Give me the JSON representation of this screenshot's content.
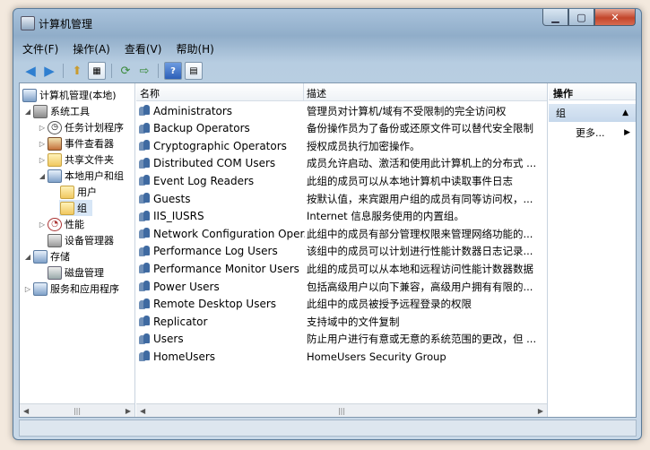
{
  "window": {
    "title": "计算机管理"
  },
  "menu": [
    "文件(F)",
    "操作(A)",
    "查看(V)",
    "帮助(H)"
  ],
  "toolbar": [
    "back-icon",
    "forward-icon",
    "up-icon",
    "show-tree-icon",
    "refresh-icon",
    "export-icon",
    "help-icon",
    "properties-icon"
  ],
  "tree": [
    {
      "label": "计算机管理(本地)",
      "icon": "computer-management-icon"
    },
    {
      "label": "系统工具",
      "icon": "tools-icon"
    },
    {
      "label": "任务计划程序",
      "icon": "clock-icon"
    },
    {
      "label": "事件查看器",
      "icon": "event-viewer-icon"
    },
    {
      "label": "共享文件夹",
      "icon": "shared-folder-icon"
    },
    {
      "label": "本地用户和组",
      "icon": "users-icon"
    },
    {
      "label": "用户",
      "icon": "folder-icon"
    },
    {
      "label": "组",
      "icon": "folder-icon"
    },
    {
      "label": "性能",
      "icon": "performance-icon"
    },
    {
      "label": "设备管理器",
      "icon": "device-manager-icon"
    },
    {
      "label": "存储",
      "icon": "storage-icon"
    },
    {
      "label": "磁盘管理",
      "icon": "disk-icon"
    },
    {
      "label": "服务和应用程序",
      "icon": "services-icon"
    }
  ],
  "list": {
    "col_name": "名称",
    "col_desc": "描述",
    "rows": [
      {
        "name": "Administrators",
        "desc": "管理员对计算机/域有不受限制的完全访问权"
      },
      {
        "name": "Backup Operators",
        "desc": "备份操作员为了备份或还原文件可以替代安全限制"
      },
      {
        "name": "Cryptographic Operators",
        "desc": "授权成员执行加密操作。"
      },
      {
        "name": "Distributed COM Users",
        "desc": "成员允许启动、激活和使用此计算机上的分布式 ..."
      },
      {
        "name": "Event Log Readers",
        "desc": "此组的成员可以从本地计算机中读取事件日志"
      },
      {
        "name": "Guests",
        "desc": "按默认值，来宾跟用户组的成员有同等访问权，..."
      },
      {
        "name": "IIS_IUSRS",
        "desc": "Internet 信息服务使用的内置组。"
      },
      {
        "name": "Network Configuration Oper...",
        "desc": "此组中的成员有部分管理权限来管理网络功能的..."
      },
      {
        "name": "Performance Log Users",
        "desc": "该组中的成员可以计划进行性能计数器日志记录..."
      },
      {
        "name": "Performance Monitor Users",
        "desc": "此组的成员可以从本地和远程访问性能计数器数据"
      },
      {
        "name": "Power Users",
        "desc": "包括高级用户以向下兼容，高级用户拥有有限的..."
      },
      {
        "name": "Remote Desktop Users",
        "desc": "此组中的成员被授予远程登录的权限"
      },
      {
        "name": "Replicator",
        "desc": "支持域中的文件复制"
      },
      {
        "name": "Users",
        "desc": "防止用户进行有意或无意的系统范围的更改，但 ..."
      },
      {
        "name": "HomeUsers",
        "desc": "HomeUsers Security Group"
      }
    ]
  },
  "actions": {
    "header": "操作",
    "group": "组",
    "more": "更多..."
  }
}
